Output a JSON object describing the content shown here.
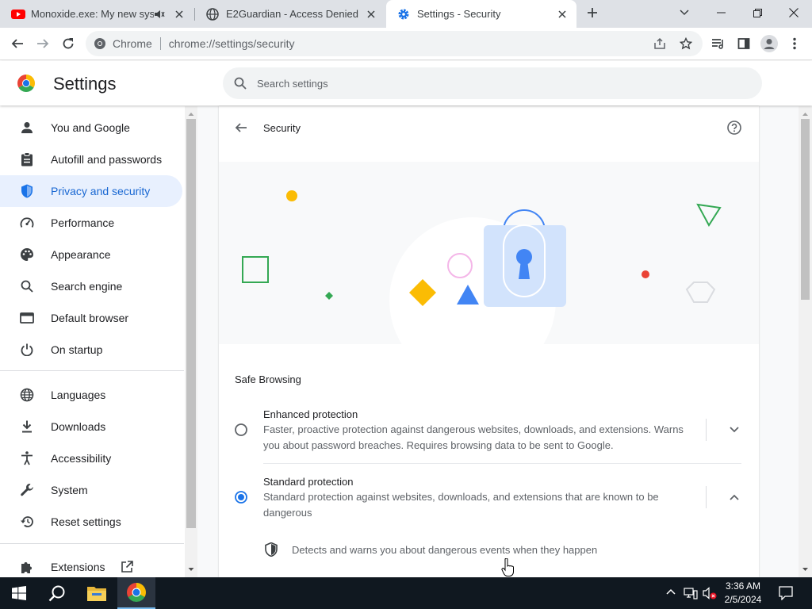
{
  "tabs": [
    {
      "title": "Monoxide.exe: My new syste",
      "icon": "youtube-icon",
      "active": false
    },
    {
      "title": "E2Guardian - Access Denied",
      "icon": "globe-icon",
      "active": false
    },
    {
      "title": "Settings - Security",
      "icon": "settings-gear-icon",
      "active": true
    }
  ],
  "omnibox": {
    "chip": "Chrome",
    "url": "chrome://settings/security"
  },
  "settings": {
    "title": "Settings",
    "search_placeholder": "Search settings"
  },
  "sidebar": {
    "items": [
      {
        "label": "You and Google",
        "icon": "person-icon"
      },
      {
        "label": "Autofill and passwords",
        "icon": "clipboard-icon"
      },
      {
        "label": "Privacy and security",
        "icon": "shield-icon",
        "selected": true
      },
      {
        "label": "Performance",
        "icon": "speedometer-icon"
      },
      {
        "label": "Appearance",
        "icon": "palette-icon"
      },
      {
        "label": "Search engine",
        "icon": "search-icon"
      },
      {
        "label": "Default browser",
        "icon": "browser-icon"
      },
      {
        "label": "On startup",
        "icon": "power-icon"
      }
    ],
    "advanced": [
      {
        "label": "Languages",
        "icon": "globe-icon"
      },
      {
        "label": "Downloads",
        "icon": "download-icon"
      },
      {
        "label": "Accessibility",
        "icon": "accessibility-icon"
      },
      {
        "label": "System",
        "icon": "wrench-icon"
      },
      {
        "label": "Reset settings",
        "icon": "reset-icon"
      }
    ],
    "extensions": {
      "label": "Extensions",
      "icon": "puzzle-icon"
    }
  },
  "page": {
    "title": "Security",
    "section_heading": "Safe Browsing",
    "options": [
      {
        "title": "Enhanced protection",
        "description": "Faster, proactive protection against dangerous websites, downloads, and extensions. Warns you about password breaches. Requires browsing data to be sent to Google.",
        "selected": false,
        "expanded": false
      },
      {
        "title": "Standard protection",
        "description": "Standard protection against websites, downloads, and extensions that are known to be dangerous",
        "selected": true,
        "expanded": true
      }
    ],
    "detail_line": "Detects and warns you about dangerous events when they happen"
  },
  "taskbar": {
    "time": "3:36 AM",
    "date": "2/5/2024"
  },
  "colors": {
    "accent": "#1a73e8",
    "selected_nav_bg": "#e8f0fe",
    "taskbar": "#101820"
  }
}
